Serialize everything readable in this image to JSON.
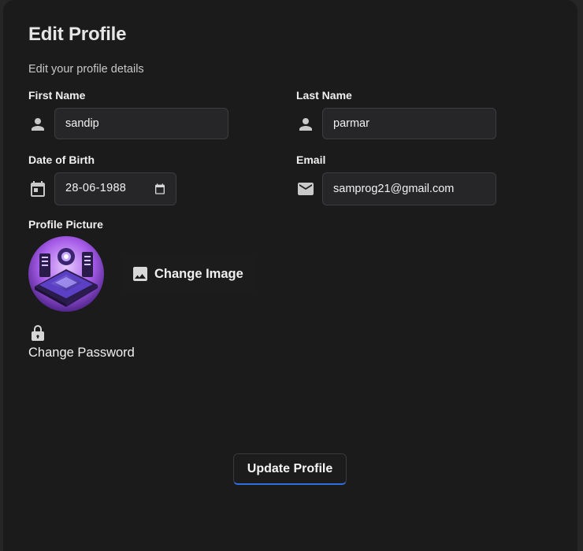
{
  "header": {
    "title": "Edit Profile",
    "subtitle": "Edit your profile details"
  },
  "fields": {
    "first_name": {
      "label": "First Name",
      "value": "sandip",
      "icon": "person-icon"
    },
    "last_name": {
      "label": "Last Name",
      "value": "parmar",
      "icon": "person-icon"
    },
    "dob": {
      "label": "Date of Birth",
      "value": "28-06-1988",
      "icon": "calendar-icon"
    },
    "email": {
      "label": "Email",
      "value": "samprog21@gmail.com",
      "icon": "mail-icon"
    }
  },
  "profile_picture": {
    "label": "Profile Picture",
    "change_label": "Change Image",
    "icon": "image-icon"
  },
  "password": {
    "label": "Change Password",
    "icon": "lock-icon"
  },
  "actions": {
    "update_label": "Update Profile"
  },
  "colors": {
    "background": "#1b1b1c",
    "input_bg": "#262628",
    "accent": "#2f6fe0"
  }
}
